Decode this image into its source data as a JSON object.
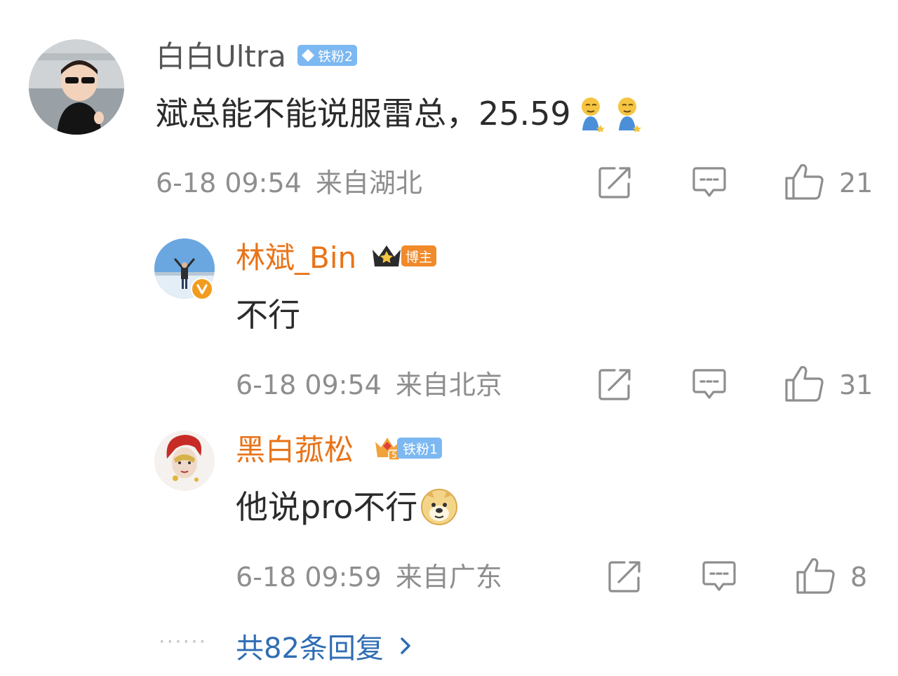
{
  "comments": [
    {
      "username": "白白Ultra",
      "fan_badge": "铁粉2",
      "text": "斌总能不能说服雷总，25.59",
      "emoji": "smirk-emoji",
      "timestamp": "6-18 09:54",
      "location": "来自湖北",
      "likes": "21"
    },
    {
      "username": "林斌_Bin",
      "role_badge": "博主",
      "text": "不行",
      "timestamp": "6-18 09:54",
      "location": "来自北京",
      "likes": "31"
    },
    {
      "username": "黑白菰松",
      "fan_badge": "铁粉1",
      "level": "5",
      "text": "他说pro不行",
      "emoji": "doge-emoji",
      "timestamp": "6-18 09:59",
      "location": "来自广东",
      "likes": "8"
    }
  ],
  "more_replies": {
    "label": "共82条回复",
    "dots": "······"
  },
  "colors": {
    "name_gray": "#555555",
    "name_orange": "#e8741a",
    "meta_gray": "#8e8e8e",
    "link_blue": "#2f6db3",
    "fan_badge_blue": "#7cb8f1",
    "blogger_badge_orange": "#f08a2a"
  }
}
